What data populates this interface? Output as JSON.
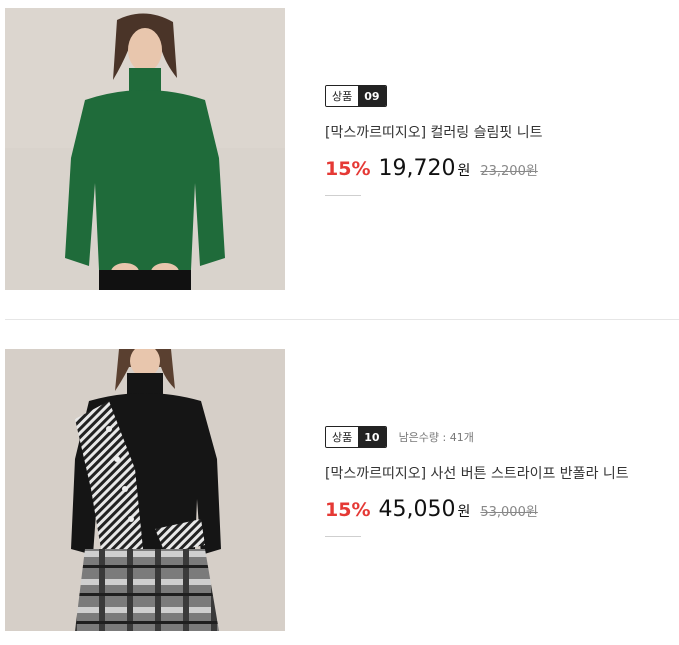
{
  "products": [
    {
      "badge_label": "상품",
      "badge_number": "09",
      "stock_text": "",
      "title": "[막스까르띠지오] 컬러링 슬림핏 니트",
      "discount": "15%",
      "price": "19,720",
      "price_unit": "원",
      "original_price": "23,200원",
      "image": {
        "description_icon": "green-turtleneck-sweater-photo",
        "sweater_color": "#1f6b3a",
        "background": "#d8d2cb"
      }
    },
    {
      "badge_label": "상품",
      "badge_number": "10",
      "stock_text": "남은수량 : 41개",
      "title": "[막스까르띠지오] 사선 버튼 스트라이프 반폴라 니트",
      "discount": "15%",
      "price": "45,050",
      "price_unit": "원",
      "original_price": "53,000원",
      "image": {
        "description_icon": "black-striped-knit-photo",
        "sweater_color": "#151515",
        "background": "#d6cfc8"
      }
    }
  ],
  "colors": {
    "discount": "#e53935",
    "badge_dark": "#222222"
  }
}
